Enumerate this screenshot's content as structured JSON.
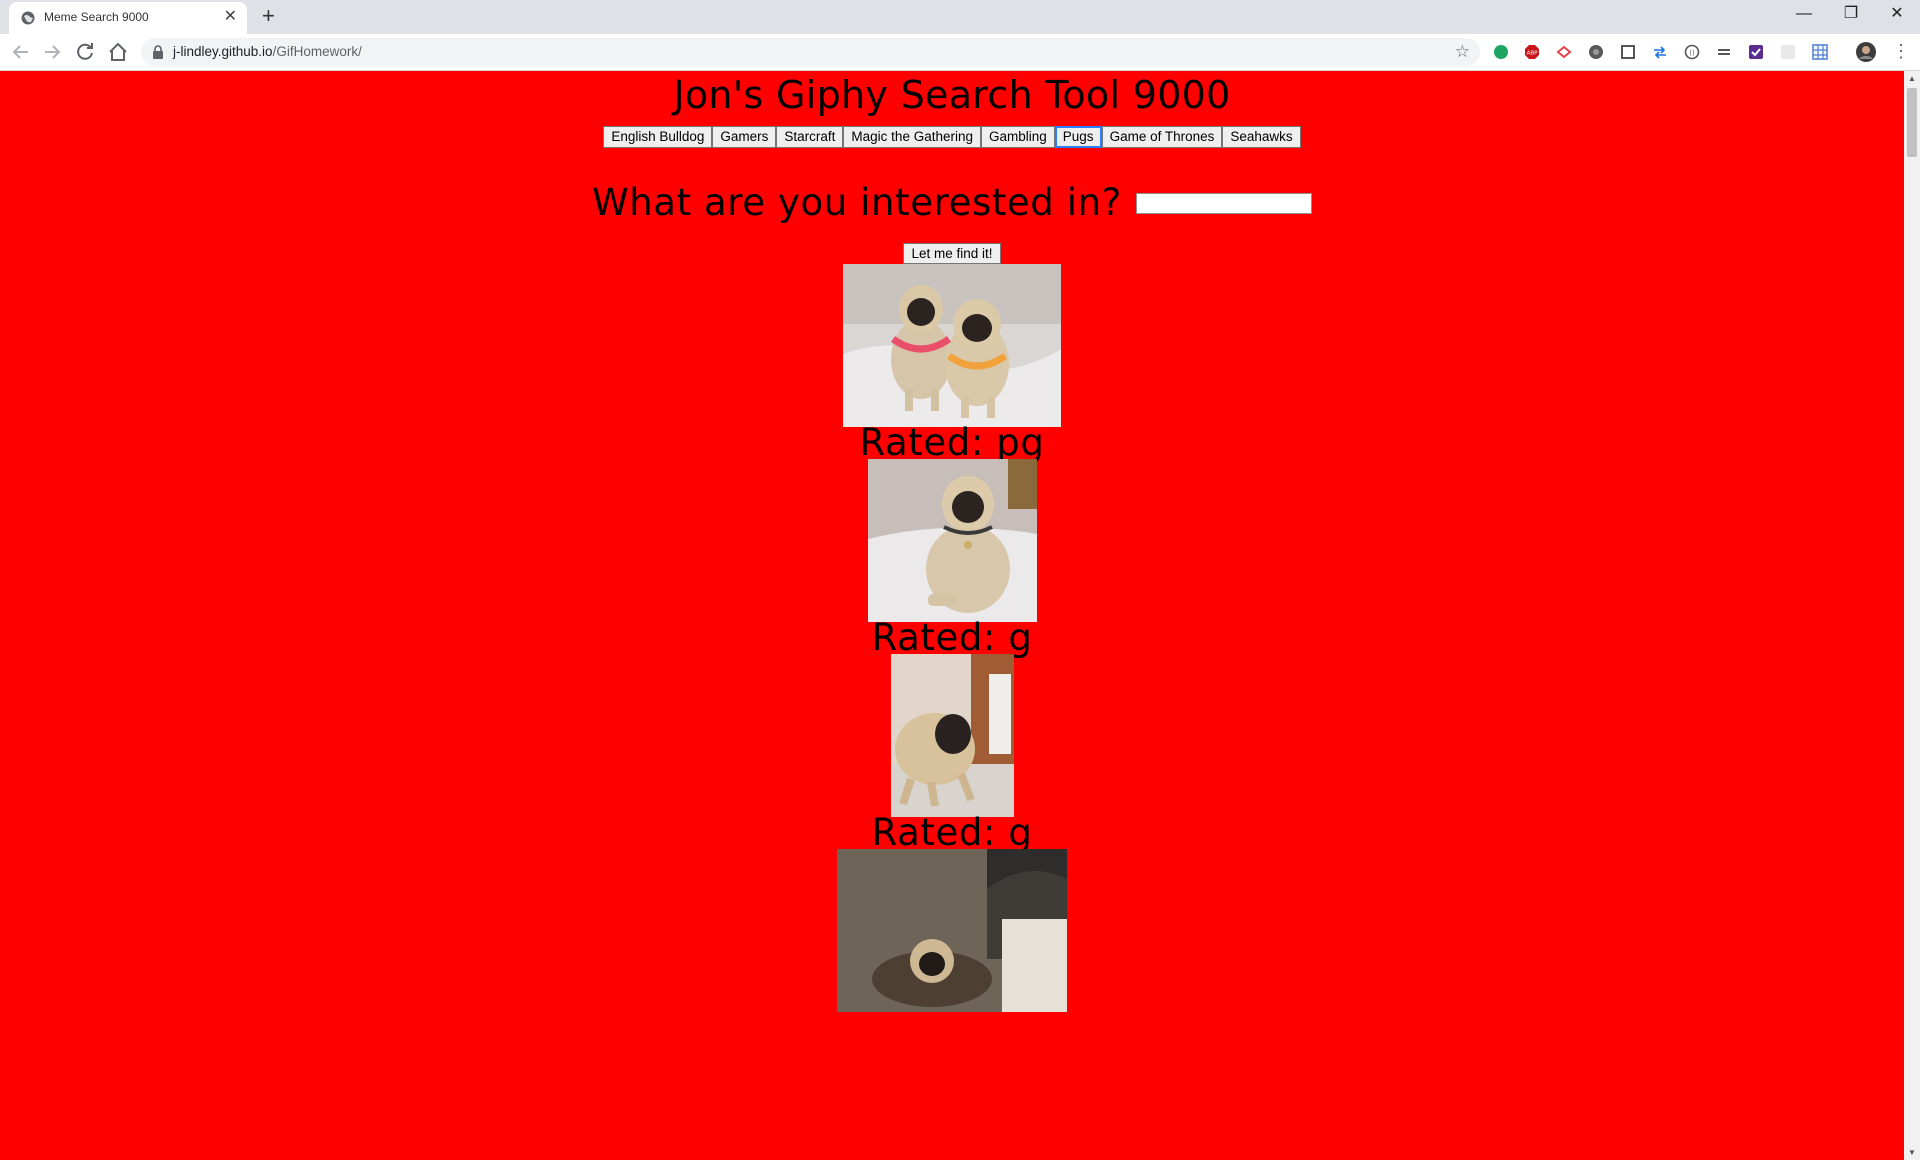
{
  "browser": {
    "tab_title": "Meme Search 9000",
    "tab_close": "✕",
    "new_tab": "+",
    "url_host": "j-lindley.github.io",
    "url_path": "/GifHomework/",
    "window_controls": {
      "minimize": "—",
      "restore": "❐",
      "close": "✕"
    },
    "extensions": [
      "green-ext-icon",
      "adblock-icon",
      "red-ext-icon",
      "dark-circle-ext-icon",
      "screenshot-ext-icon",
      "arrows-ext-icon",
      "circle-ext-icon",
      "lines-ext-icon",
      "purple-check-ext-icon",
      "blank-ext-icon",
      "grid-ext-icon",
      "profile-avatar-icon"
    ]
  },
  "page": {
    "title": "Jon's Giphy Search Tool 9000",
    "topics": [
      "English Bulldog",
      "Gamers",
      "Starcraft",
      "Magic the Gathering",
      "Gambling",
      "Pugs",
      "Game of Thrones",
      "Seahawks"
    ],
    "active_topic": "Pugs",
    "question": "What are you interested in?",
    "search_value": "",
    "find_button": "Let me find it!",
    "results": [
      {
        "rating": "Rated: pg"
      },
      {
        "rating": "Rated: g"
      },
      {
        "rating": "Rated: g"
      },
      {
        "rating": ""
      }
    ]
  },
  "colors": {
    "page_background": "#ff0000",
    "active_topic_border": "#2a7fff"
  }
}
